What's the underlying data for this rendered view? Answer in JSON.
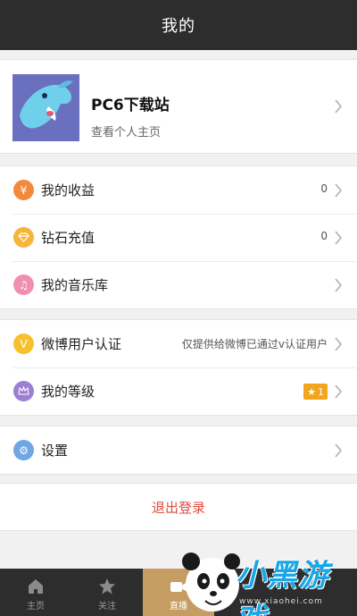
{
  "header": {
    "title": "我的"
  },
  "profile": {
    "name": "PC6下载站",
    "subtitle": "查看个人主页"
  },
  "groups": {
    "earnings": {
      "rows": [
        {
          "label": "我的收益",
          "value": "0",
          "icon": "yuan-icon",
          "color": "#f28a3c"
        },
        {
          "label": "钻石充值",
          "value": "0",
          "icon": "diamond-icon",
          "color": "#f5b53a"
        },
        {
          "label": "我的音乐库",
          "value": "",
          "icon": "music-icon",
          "color": "#f08fb0"
        }
      ]
    },
    "account": {
      "rows": [
        {
          "label": "微博用户认证",
          "value": "仅提供给微博已通过v认证用户",
          "icon": "verify-v-icon",
          "icon_text": "V",
          "color": "#f6c12c"
        },
        {
          "label": "我的等级",
          "badge": "1",
          "icon": "crown-icon",
          "color": "#9c7fd1"
        }
      ]
    },
    "settings": {
      "rows": [
        {
          "label": "设置",
          "icon": "gear-icon",
          "color": "#6fa6e3"
        }
      ]
    }
  },
  "logout": {
    "label": "退出登录",
    "color": "#e04a3c"
  },
  "tabbar": {
    "tabs": [
      {
        "label": "主页",
        "icon": "home-icon"
      },
      {
        "label": "关注",
        "icon": "star-icon"
      },
      {
        "label": "直播",
        "icon": "camera-icon",
        "active": true
      }
    ]
  },
  "watermark": {
    "text": "小黑游戏",
    "url": "www.xiaohei.com"
  },
  "colors": {
    "topbar": "#2d2d2d",
    "active_tab": "#c59d63",
    "background": "#f1f1f1"
  }
}
